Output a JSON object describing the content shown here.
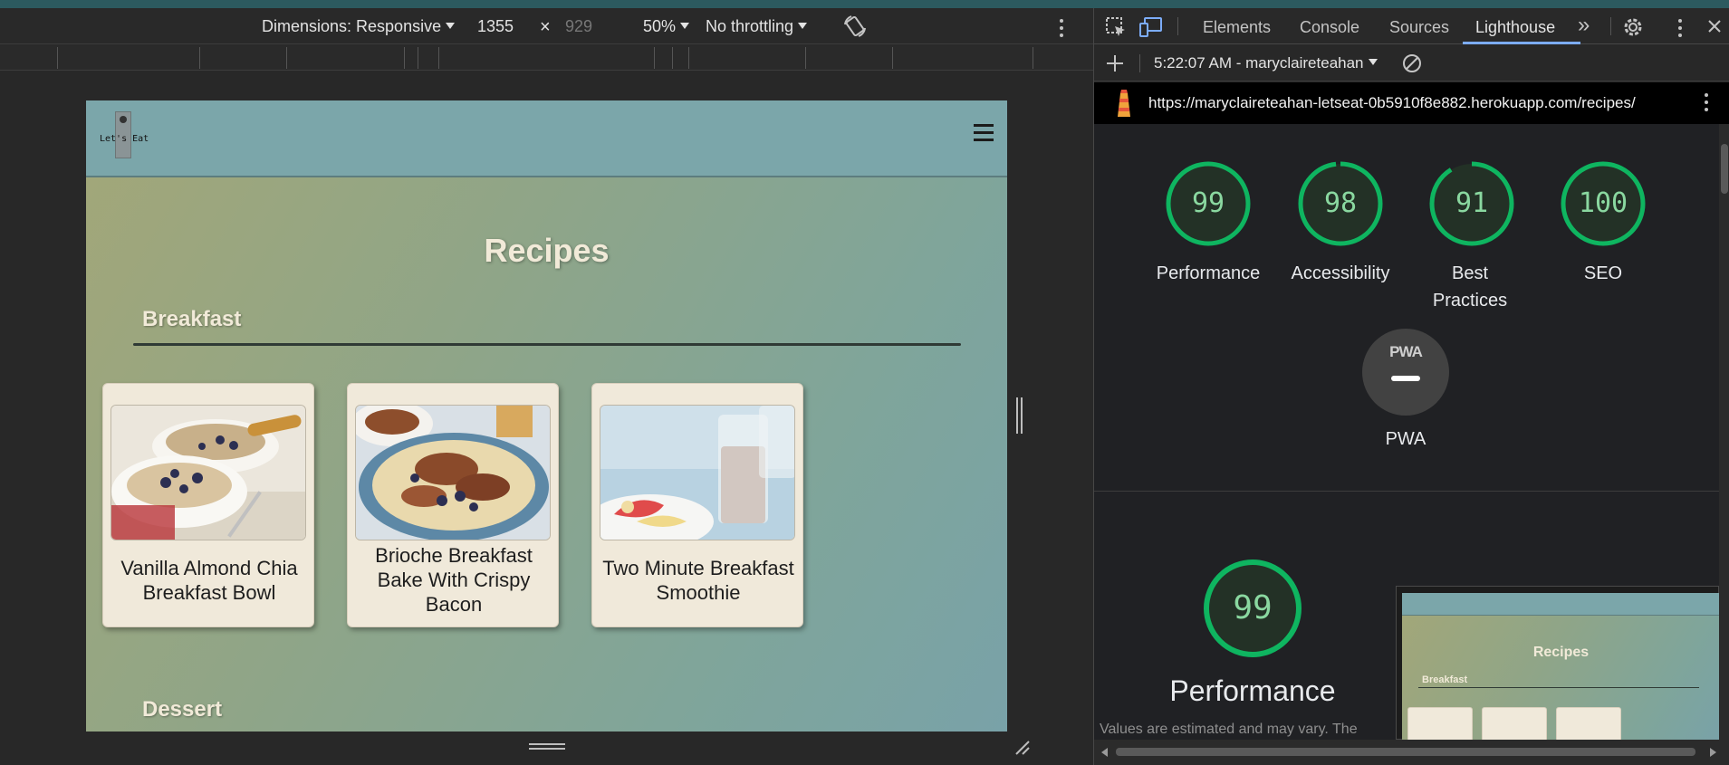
{
  "device_toolbar": {
    "dimensions_label": "Dimensions: Responsive",
    "width_value": "1355",
    "times": "×",
    "height_value": "929",
    "zoom": "50%",
    "throttling": "No throttling"
  },
  "site": {
    "logo_text": "Let's Eat",
    "title": "Recipes",
    "sections": [
      {
        "heading": "Breakfast"
      },
      {
        "heading": "Dessert"
      }
    ],
    "cards": [
      {
        "title": "Vanilla Almond Chia Breakfast Bowl"
      },
      {
        "title": "Brioche Breakfast Bake With Crispy Bacon"
      },
      {
        "title": "Two Minute Breakfast Smoothie"
      }
    ]
  },
  "devtools": {
    "tabs": [
      "Elements",
      "Console",
      "Sources",
      "Lighthouse"
    ],
    "active_tab": "Lighthouse",
    "more_tabs": "»",
    "report_selector": "5:22:07 AM - maryclaireteahan",
    "url": "https://maryclaireteahan-letseat-0b5910f8e882.herokuapp.com/recipes/",
    "scores": [
      {
        "label": "Performance",
        "score": 99
      },
      {
        "label": "Accessibility",
        "score": 98
      },
      {
        "label": "Best Practices",
        "score": 91
      },
      {
        "label": "SEO",
        "score": 100
      }
    ],
    "pwa": {
      "badge_text": "PWA",
      "label": "PWA"
    },
    "performance_section": {
      "score": "99",
      "title": "Performance",
      "note": "Values are estimated and may vary. The"
    },
    "thumbnail": {
      "title": "Recipes",
      "section": "Breakfast"
    }
  },
  "colors": {
    "gauge_pass": "#0cce6b",
    "active_tab_underline": "#7cacf8",
    "page_header": "#7ba6aa"
  }
}
